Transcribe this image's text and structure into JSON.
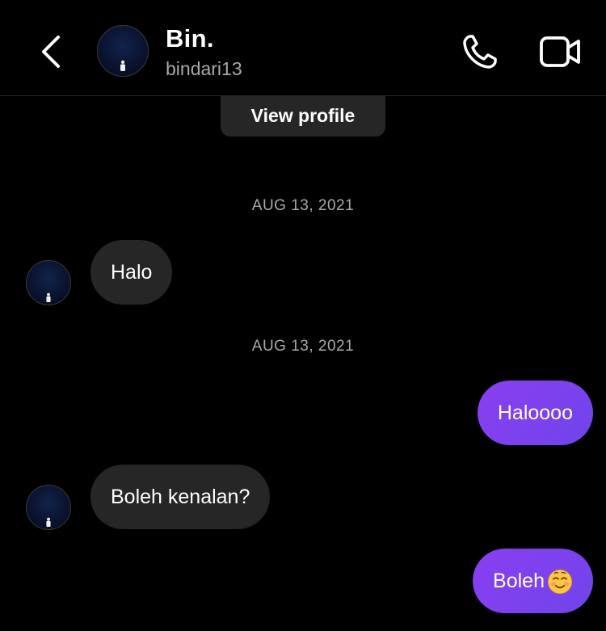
{
  "header": {
    "name": "Bin.",
    "username": "bindari13"
  },
  "view_profile_label": "View profile",
  "dates": [
    "AUG 13, 2021",
    "AUG 13, 2021"
  ],
  "messages": [
    {
      "direction": "incoming",
      "text": "Halo"
    },
    {
      "direction": "outgoing",
      "text": "Haloooo"
    },
    {
      "direction": "incoming",
      "text": "Boleh kenalan?"
    },
    {
      "direction": "outgoing",
      "text": "Boleh",
      "emoji": "smiling-face-icon"
    }
  ],
  "colors": {
    "background": "#000000",
    "incoming_bubble": "#262626",
    "outgoing_bubble": "#7A42EE",
    "secondary_text": "#A8A8A8"
  },
  "icons": [
    "back-chevron-icon",
    "phone-icon",
    "video-camera-icon"
  ]
}
